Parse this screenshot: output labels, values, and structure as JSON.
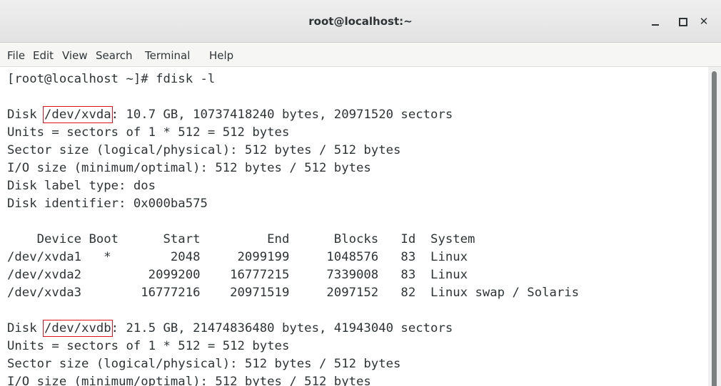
{
  "window": {
    "title": "root@localhost:~"
  },
  "menu": [
    "File",
    "Edit",
    "View",
    "Search",
    "Terminal",
    "Help"
  ],
  "terminal": {
    "prompt": "[root@localhost ~]# fdisk -l",
    "disk1": {
      "prefix": "Disk ",
      "device": "/dev/xvda",
      "suffix": ": 10.7 GB, 10737418240 bytes, 20971520 sectors",
      "units": "Units = sectors of 1 * 512 = 512 bytes",
      "sector_size": "Sector size (logical/physical): 512 bytes / 512 bytes",
      "io_size": "I/O size (minimum/optimal): 512 bytes / 512 bytes",
      "label_type": "Disk label type: dos",
      "identifier": "Disk identifier: 0x000ba575"
    },
    "partition_table": {
      "header": "    Device Boot      Start         End      Blocks   Id  System",
      "rows": [
        "/dev/xvda1   *        2048     2099199     1048576   83  Linux",
        "/dev/xvda2         2099200    16777215     7339008   83  Linux",
        "/dev/xvda3        16777216    20971519     2097152   82  Linux swap / Solaris"
      ]
    },
    "disk2": {
      "prefix": "Disk ",
      "device": "/dev/xvdb",
      "suffix": ": 21.5 GB, 21474836480 bytes, 41943040 sectors",
      "units": "Units = sectors of 1 * 512 = 512 bytes",
      "sector_size": "Sector size (logical/physical): 512 bytes / 512 bytes",
      "io_size": "I/O size (minimum/optimal): 512 bytes / 512 bytes"
    }
  },
  "colors": {
    "highlight_box": "#e0111d",
    "text": "#2e3436"
  }
}
